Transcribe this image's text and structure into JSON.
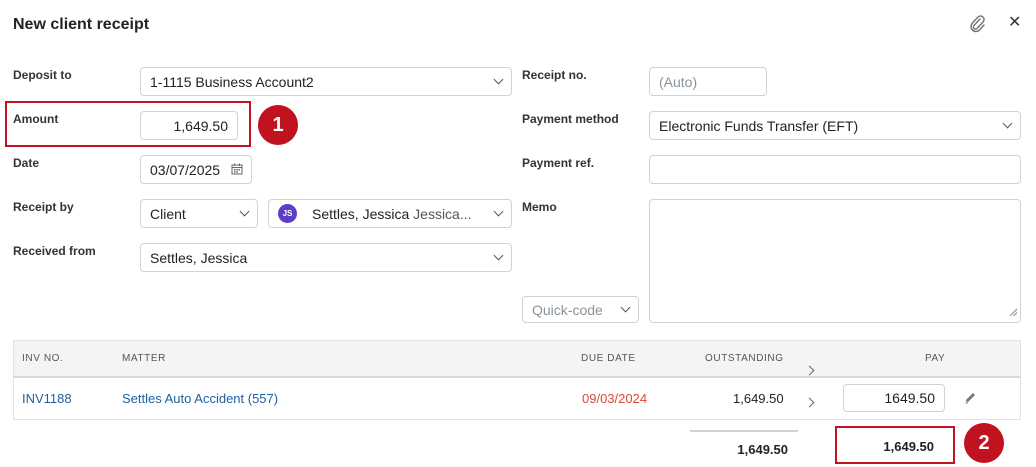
{
  "dialog": {
    "title": "New client receipt",
    "attach_icon": "paperclip-icon",
    "close_icon": "close-icon",
    "close_glyph": "✕"
  },
  "form": {
    "deposit_to": {
      "label": "Deposit to",
      "value": "1-1115 Business Account2"
    },
    "amount": {
      "label": "Amount",
      "value": "1,649.50"
    },
    "date": {
      "label": "Date",
      "value": "03/07/2025"
    },
    "receipt_by": {
      "label": "Receipt by",
      "type_value": "Client",
      "avatar_initials": "JS",
      "client_name": "Settles, Jessica",
      "client_sub": "Jessica..."
    },
    "received_from": {
      "label": "Received from",
      "value": "Settles, Jessica"
    },
    "receipt_no": {
      "label": "Receipt no.",
      "placeholder": "(Auto)"
    },
    "payment_method": {
      "label": "Payment method",
      "value": "Electronic Funds Transfer (EFT)"
    },
    "payment_ref": {
      "label": "Payment ref.",
      "value": ""
    },
    "memo": {
      "label": "Memo",
      "value": ""
    },
    "quick_code": {
      "placeholder": "Quick-code"
    }
  },
  "annotations": {
    "badge_1": "1",
    "badge_2": "2",
    "highlight_color": "#c1121f"
  },
  "table": {
    "headers": {
      "inv_no": "INV NO.",
      "matter": "MATTER",
      "due_date": "DUE DATE",
      "outstanding": "OUTSTANDING",
      "pay": "PAY"
    },
    "rows": [
      {
        "inv_no": "INV1188",
        "matter": "Settles Auto Accident (557)",
        "due_date": "09/03/2024",
        "outstanding": "1,649.50",
        "pay": "1649.50"
      }
    ],
    "totals": {
      "outstanding": "1,649.50",
      "pay": "1,649.50"
    }
  }
}
